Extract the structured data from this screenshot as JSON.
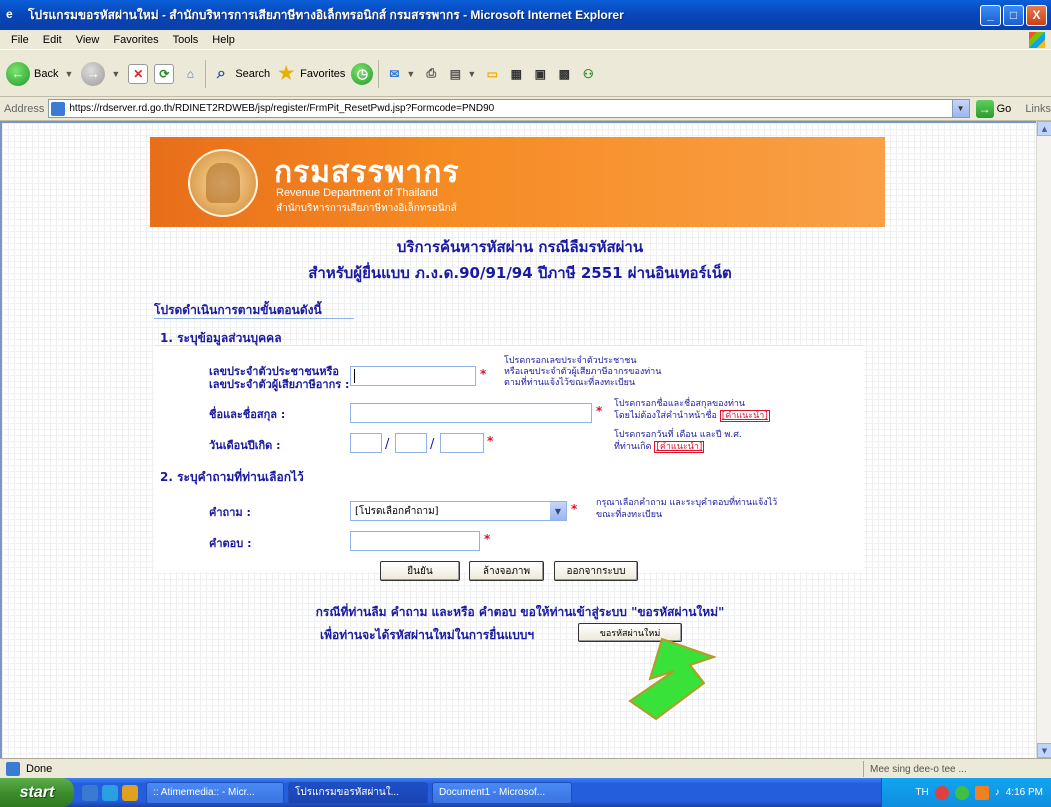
{
  "window": {
    "title": "โปรแกรมขอรหัสผ่านใหม่ - สำนักบริหารการเสียภาษีทางอิเล็กทรอนิกส์ กรมสรรพากร - Microsoft Internet Explorer",
    "minimize": "_",
    "maximize": "□",
    "close": "X"
  },
  "menu": [
    "File",
    "Edit",
    "View",
    "Favorites",
    "Tools",
    "Help"
  ],
  "toolbar": {
    "back_label": "Back",
    "search_label": "Search",
    "favorites_label": "Favorites"
  },
  "address": {
    "label": "Address",
    "url": "https://rdserver.rd.go.th/RDINET2RDWEB/jsp/register/FrmPit_ResetPwd.jsp?Formcode=PND90",
    "go_label": "Go",
    "links_label": "Links"
  },
  "banner": {
    "title": "กรมสรรพากร",
    "subtitle_en": "Revenue Department of Thailand",
    "subtitle_th": "สำนักบริหารการเสียภาษีทางอิเล็กทรอนิกส์"
  },
  "page": {
    "heading1": "บริการค้นหารหัสผ่าน กรณีลืมรหัสผ่าน",
    "heading2": "สำหรับผู้ยื่นแบบ ภ.ง.ด.90/91/94 ปีภาษี 2551 ผ่านอินเทอร์เน็ต",
    "instruction": "โปรดดำเนินการตามขั้นตอนดังนี้",
    "section1": "1. ระบุข้อมูลส่วนบุคคล",
    "section2": "2. ระบุคำถามที่ท่านเลือกไว้",
    "id_label_1": "เลขประจำตัวประชาชนหรือ",
    "id_label_2": "เลขประจำตัวผู้เสียภาษีอากร :",
    "id_value": "",
    "id_help_1": "โปรดกรอกเลขประจำตัวประชาชน",
    "id_help_2": "หรือเลขประจำตัวผู้เสียภาษีอากรของท่าน",
    "id_help_3": "ตามที่ท่านแจ้งไว้ขณะที่ลงทะเบียน",
    "name_label": "ชื่อและชื่อสกุล :",
    "name_help_1": "โปรดกรอกชื่อและชื่อสกุลของท่าน",
    "name_help_2": "โดยไม่ต้องใส่คำนำหน้าชื่อ",
    "name_help_link": "[คำแนะนำ]",
    "dob_label": "วันเดือนปีเกิด :",
    "dob_help_1": "โปรดกรอกวันที่ เดือน และปี พ.ศ.",
    "dob_help_2": "ที่ท่านเกิด",
    "dob_help_link": "[คำแนะนำ]",
    "question_label": "คำถาม :",
    "question_selected": "[โปรดเลือกคำถาม]",
    "question_help_1": "กรุณาเลือกคำถาม และระบุคำตอบที่ท่านแจ้งไว้",
    "question_help_2": "ขณะที่ลงทะเบียน",
    "answer_label": "คำตอบ :",
    "confirm_button": "ยืนยัน",
    "clear_button": "ล้างจอภาพ",
    "exit_button": "ออกจากระบบ",
    "note1": "กรณีที่ท่านลืม คำถาม และหรือ คำตอบ ขอให้ท่านเข้าสู่ระบบ \"ขอรหัสผ่านใหม่\"",
    "note2": "เพื่อท่านจะได้รหัสผ่านใหม่ในการยื่นแบบฯ",
    "new_password_button": "ขอรหัสผ่านใหม่",
    "required_mark": "*"
  },
  "status": {
    "text": "Done",
    "zone": "Mee sing dee-o tee ..."
  },
  "taskbar": {
    "start_label": "start",
    "tasks": [
      ":: Atimemedia:: - Micr...",
      "โปรแกรมขอรหัสผ่านใ...",
      "Document1 - Microsof..."
    ],
    "tray_lang": "TH",
    "time": "4:16 PM"
  },
  "colors": {
    "brand_orange": "#f68b23",
    "text_blue": "#1a1aa0",
    "required_red": "#e0102a",
    "arrow_green": "#39e239"
  }
}
